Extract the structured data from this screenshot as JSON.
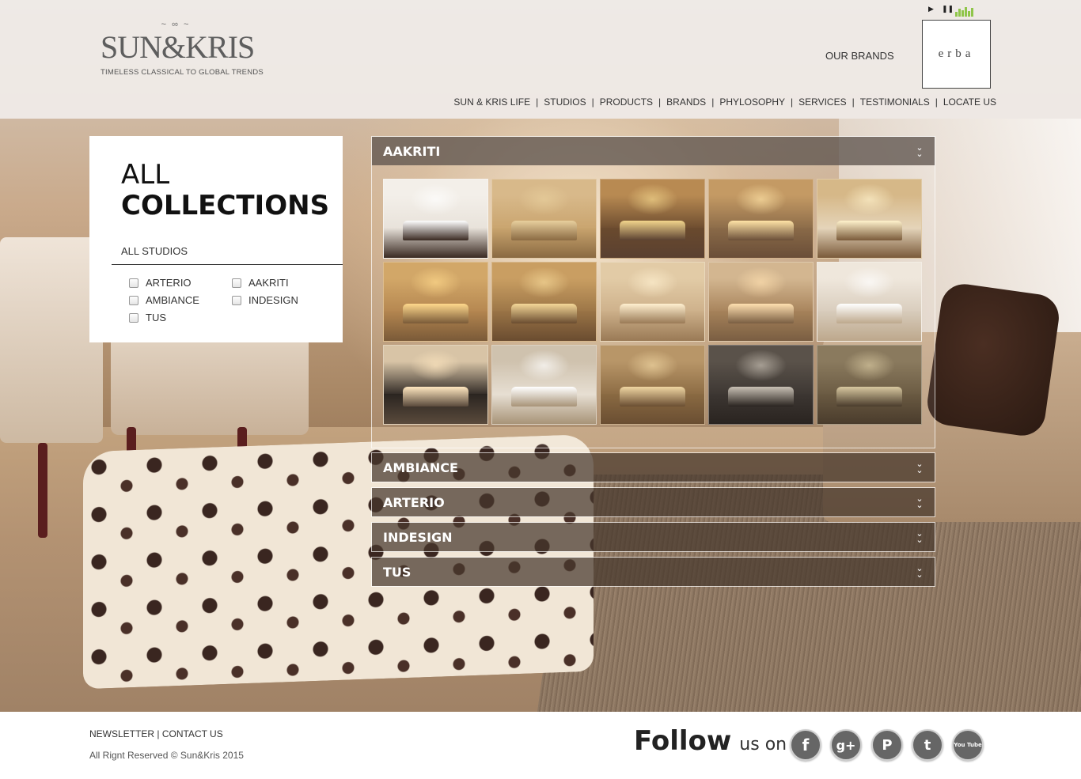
{
  "header": {
    "logo_text": "SUN&KRIS",
    "logo_tagline": "TIMELESS CLASSICAL TO GLOBAL TRENDS",
    "our_brands_label": "OUR BRANDS",
    "brand_logo_text": "erba",
    "music": {
      "play_icon": "play-icon",
      "pause_icon": "pause-icon",
      "eq_icon": "equalizer-icon",
      "eq_color": "#8fc54a"
    },
    "nav": [
      {
        "label": "SUN & KRIS LIFE"
      },
      {
        "label": "STUDIOS"
      },
      {
        "label": "PRODUCTS"
      },
      {
        "label": "BRANDS"
      },
      {
        "label": "PHYLOSOPHY"
      },
      {
        "label": "SERVICES"
      },
      {
        "label": "TESTIMONIALS"
      },
      {
        "label": "LOCATE US"
      }
    ]
  },
  "sidebar": {
    "title_line1": "ALL",
    "title_line2": "COLLECTIONS",
    "filter_heading": "ALL STUDIOS",
    "checkboxes": [
      {
        "label": "ARTERIO",
        "checked": false
      },
      {
        "label": "AAKRITI",
        "checked": false
      },
      {
        "label": "AMBIANCE",
        "checked": false
      },
      {
        "label": "INDESIGN",
        "checked": false
      },
      {
        "label": "TUS",
        "checked": false
      }
    ]
  },
  "accordion": {
    "sections": [
      {
        "label": "AAKRITI",
        "expanded": true
      },
      {
        "label": "AMBIANCE",
        "expanded": false
      },
      {
        "label": "ARTERIO",
        "expanded": false
      },
      {
        "label": "INDESIGN",
        "expanded": false
      },
      {
        "label": "TUS",
        "expanded": false
      }
    ],
    "chevron_icon": "double-chevron-down-icon",
    "gallery_thumbnails": 15
  },
  "footer": {
    "newsletter": "NEWSLETTER",
    "separator": "|",
    "contact": "CONTACT US",
    "copyright": "All Rignt Reserved © Sun&Kris 2015",
    "follow_big": "Follow",
    "follow_small": "us on",
    "social": [
      {
        "icon": "facebook-icon",
        "glyph": "f"
      },
      {
        "icon": "google-plus-icon",
        "glyph": "g+"
      },
      {
        "icon": "pinterest-icon",
        "glyph": "P"
      },
      {
        "icon": "twitter-icon",
        "glyph": "t"
      },
      {
        "icon": "youtube-icon",
        "glyph": "You Tube"
      }
    ]
  },
  "colors": {
    "accordion_header": "#5f554e",
    "panel_bg": "#ffffff",
    "footer_bg": "#ffffff",
    "social_bg": "#666666"
  }
}
